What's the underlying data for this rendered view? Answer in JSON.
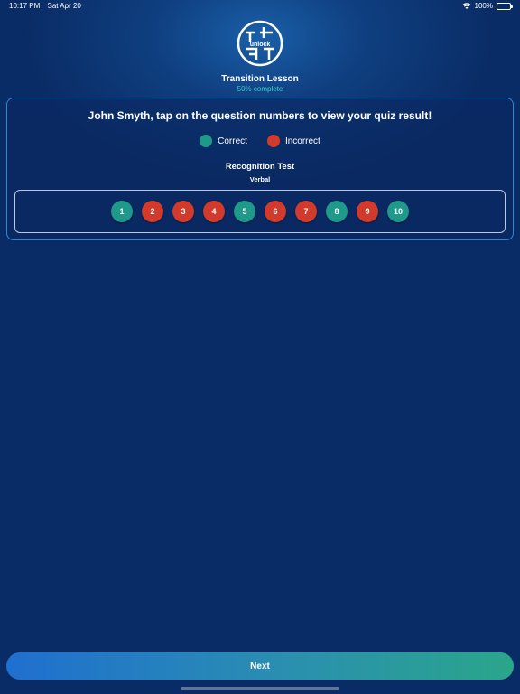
{
  "status_bar": {
    "time": "10:17 PM",
    "date": "Sat Apr 20",
    "battery": "100%",
    "wifi_icon": "wifi-icon",
    "battery_icon": "battery-icon"
  },
  "header": {
    "logo_text": "unlock",
    "lesson_title": "Transition Lesson",
    "progress_text": "50% complete"
  },
  "result": {
    "instruction": "John Smyth, tap on the question numbers to view your quiz result!",
    "legend": [
      {
        "label": "Correct",
        "color": "#1f9a8a"
      },
      {
        "label": "Incorrect",
        "color": "#d23a2c"
      }
    ],
    "test_name": "Recognition Test",
    "test_type": "Verbal",
    "questions": [
      {
        "number": "1",
        "status": "correct"
      },
      {
        "number": "2",
        "status": "incorrect"
      },
      {
        "number": "3",
        "status": "incorrect"
      },
      {
        "number": "4",
        "status": "incorrect"
      },
      {
        "number": "5",
        "status": "correct"
      },
      {
        "number": "6",
        "status": "incorrect"
      },
      {
        "number": "7",
        "status": "incorrect"
      },
      {
        "number": "8",
        "status": "correct"
      },
      {
        "number": "9",
        "status": "incorrect"
      },
      {
        "number": "10",
        "status": "correct"
      }
    ]
  },
  "footer": {
    "next_label": "Next"
  },
  "colors": {
    "correct": "#1f9a8a",
    "incorrect": "#d23a2c",
    "background": "#0a2c66",
    "accent": "#3ed0c8"
  }
}
